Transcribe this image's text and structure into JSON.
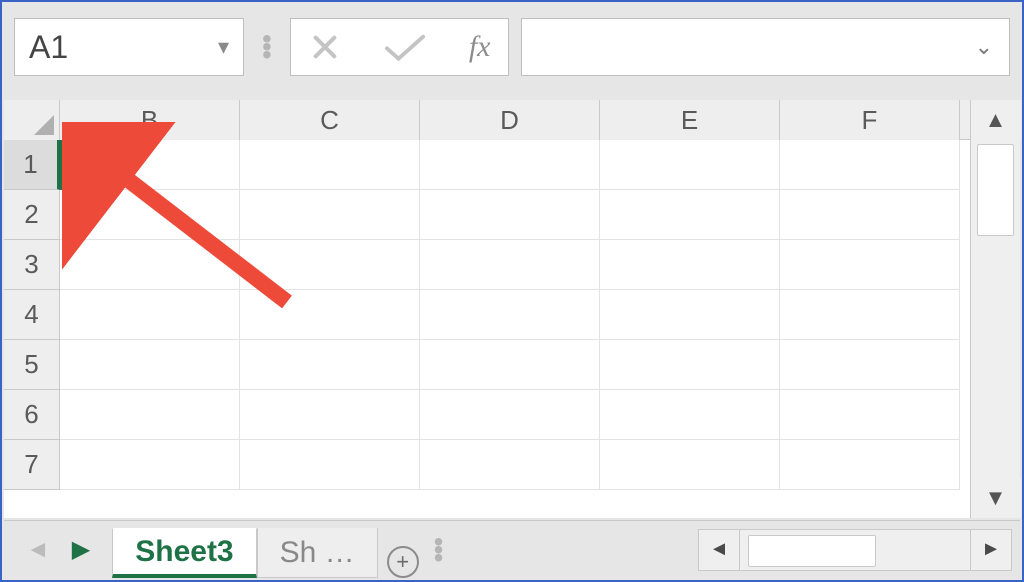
{
  "nameBox": {
    "value": "A1"
  },
  "formula": {
    "value": ""
  },
  "columns": [
    "B",
    "C",
    "D",
    "E",
    "F"
  ],
  "rows": [
    "1",
    "2",
    "3",
    "4",
    "5",
    "6",
    "7"
  ],
  "activeRow": "1",
  "tabs": {
    "active": "Sheet3",
    "truncated": "Sh …"
  },
  "icons": {
    "cancel": "cancel-icon",
    "confirm": "confirm-icon",
    "fx": "fx",
    "addSheet": "+"
  },
  "colors": {
    "accent": "#1f7246",
    "annotation": "#ed4a3a"
  }
}
